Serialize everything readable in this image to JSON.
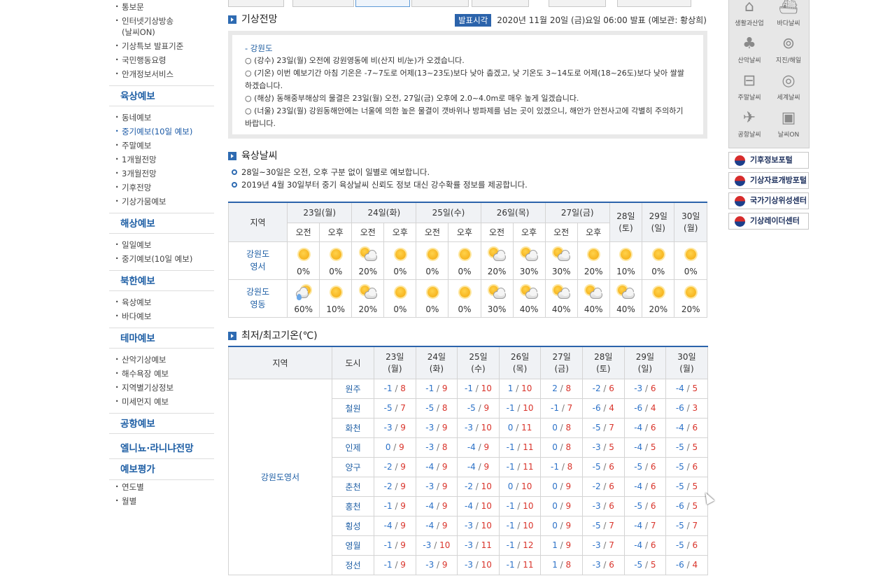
{
  "nav": {
    "group_top": [
      "통보문",
      "인터넷기상방송 (날씨ON)",
      "기상특보 발표기준",
      "국민행동요령",
      "안개정보서비스"
    ],
    "land_head": "육상예보",
    "land_items": [
      "동네예보",
      "중기예보(10일 예보)",
      "주말예보",
      "1개월전망",
      "3개월전망",
      "기후전망",
      "기상가뭄예보"
    ],
    "marine_head": "해상예보",
    "marine_items": [
      "일일예보",
      "중기예보(10일 예보)"
    ],
    "nk_head": "북한예보",
    "nk_items": [
      "육상예보",
      "바다예보"
    ],
    "theme_head": "테마예보",
    "theme_items": [
      "산악기상예보",
      "해수욕장 예보",
      "지역별기상정보",
      "미세먼지 예보"
    ],
    "airport_head": "공항예보",
    "elnino_head": "엘니뇨·라니냐전망",
    "eval_head": "예보평가",
    "eval_items": [
      "연도별",
      "월별"
    ]
  },
  "outlook": {
    "title": "기상전망",
    "pub_label": "발표시각",
    "pub_text": "2020년 11월 20일 (금)요일 06:00 발표 (예보관: 황상희)",
    "region": "- 강원도",
    "lines": [
      "○ (강수) 23일(월) 오전에 강원영동에 비(산지 비/눈)가 오겠습니다.",
      "○ (기온) 이번 예보기간 아침 기온은 -7~7도로 어제(13~23도)보다 낮아 춥겠고, 낮 기온도 3~14도로 어제(18~26도)보다 낮아 쌀쌀하겠습니다.",
      "○ (해상) 동해중부해상의 물결은 23일(월) 오전, 27일(금) 오후에 2.0~4.0m로 매우 높게 일겠습니다.",
      "○ (너울) 23일(월) 강원동해안에는 너울에 의한 높은 물결이 갯바위나 방파제를 넘는 곳이 있겠으니, 해안가 안전사고에 각별히 주의하기 바랍니다."
    ]
  },
  "land": {
    "title": "육상날씨",
    "notes": [
      "28일~30일은 오전, 오후 구분 없이 일별로 예보합니다.",
      "2019년 4월 30일부터 중기 육상날씨 신뢰도 정보 대신 강수확률 정보를 제공합니다."
    ],
    "region_header": "지역",
    "days_split": [
      "23일(월)",
      "24일(화)",
      "25일(수)",
      "26일(목)",
      "27일(금)"
    ],
    "days_single": [
      "28일\n(토)",
      "29일\n(일)",
      "30일\n(월)"
    ],
    "am": "오전",
    "pm": "오후",
    "rows": [
      {
        "region": "강원도\n영서",
        "icons": [
          "sun",
          "sun",
          "suncloud",
          "sun",
          "sun",
          "sun",
          "suncloud",
          "suncloud",
          "suncloud",
          "sun",
          "sun",
          "sun",
          "sun"
        ],
        "pct": [
          "0%",
          "0%",
          "20%",
          "0%",
          "0%",
          "0%",
          "20%",
          "30%",
          "30%",
          "20%",
          "10%",
          "0%",
          "0%"
        ]
      },
      {
        "region": "강원도\n영동",
        "icons": [
          "rain",
          "sun",
          "suncloud",
          "sun",
          "sun",
          "sun",
          "suncloud",
          "suncloud",
          "suncloud",
          "suncloud",
          "suncloud",
          "sun",
          "sun"
        ],
        "pct": [
          "60%",
          "10%",
          "20%",
          "0%",
          "0%",
          "0%",
          "30%",
          "40%",
          "40%",
          "40%",
          "40%",
          "20%",
          "20%"
        ]
      }
    ]
  },
  "temp": {
    "title": "최저/최고기온(℃)",
    "h_region": "지역",
    "h_city": "도시",
    "days": [
      "23일\n(월)",
      "24일\n(화)",
      "25일\n(수)",
      "26일\n(목)",
      "27일\n(금)",
      "28일\n(토)",
      "29일\n(일)",
      "30일\n(월)"
    ],
    "region": "강원도영서",
    "rows": [
      {
        "city": "원주",
        "v": [
          [
            "-1",
            "8"
          ],
          [
            "-1",
            "9"
          ],
          [
            "-1",
            "10"
          ],
          [
            "1",
            "10"
          ],
          [
            "2",
            "8"
          ],
          [
            "-2",
            "6"
          ],
          [
            "-3",
            "6"
          ],
          [
            "-4",
            "5"
          ]
        ]
      },
      {
        "city": "철원",
        "v": [
          [
            "-5",
            "7"
          ],
          [
            "-5",
            "8"
          ],
          [
            "-5",
            "9"
          ],
          [
            "-1",
            "10"
          ],
          [
            "-1",
            "7"
          ],
          [
            "-6",
            "4"
          ],
          [
            "-6",
            "4"
          ],
          [
            "-6",
            "3"
          ]
        ]
      },
      {
        "city": "화천",
        "v": [
          [
            "-3",
            "9"
          ],
          [
            "-3",
            "9"
          ],
          [
            "-3",
            "10"
          ],
          [
            "0",
            "11"
          ],
          [
            "0",
            "8"
          ],
          [
            "-5",
            "7"
          ],
          [
            "-4",
            "6"
          ],
          [
            "-4",
            "6"
          ]
        ]
      },
      {
        "city": "인제",
        "v": [
          [
            "0",
            "9"
          ],
          [
            "-3",
            "8"
          ],
          [
            "-4",
            "9"
          ],
          [
            "-1",
            "11"
          ],
          [
            "0",
            "8"
          ],
          [
            "-3",
            "5"
          ],
          [
            "-4",
            "5"
          ],
          [
            "-5",
            "5"
          ]
        ]
      },
      {
        "city": "양구",
        "v": [
          [
            "-2",
            "9"
          ],
          [
            "-4",
            "9"
          ],
          [
            "-4",
            "9"
          ],
          [
            "-1",
            "11"
          ],
          [
            "-1",
            "8"
          ],
          [
            "-5",
            "6"
          ],
          [
            "-5",
            "6"
          ],
          [
            "-5",
            "6"
          ]
        ]
      },
      {
        "city": "춘천",
        "v": [
          [
            "-2",
            "9"
          ],
          [
            "-3",
            "9"
          ],
          [
            "-2",
            "10"
          ],
          [
            "0",
            "10"
          ],
          [
            "0",
            "9"
          ],
          [
            "-2",
            "6"
          ],
          [
            "-4",
            "6"
          ],
          [
            "-5",
            "5"
          ]
        ]
      },
      {
        "city": "홍천",
        "v": [
          [
            "-1",
            "9"
          ],
          [
            "-4",
            "9"
          ],
          [
            "-4",
            "10"
          ],
          [
            "-1",
            "10"
          ],
          [
            "0",
            "9"
          ],
          [
            "-3",
            "6"
          ],
          [
            "-5",
            "6"
          ],
          [
            "-6",
            "5"
          ]
        ]
      },
      {
        "city": "횡성",
        "v": [
          [
            "-4",
            "9"
          ],
          [
            "-4",
            "9"
          ],
          [
            "-3",
            "10"
          ],
          [
            "-1",
            "10"
          ],
          [
            "0",
            "9"
          ],
          [
            "-5",
            "7"
          ],
          [
            "-4",
            "7"
          ],
          [
            "-5",
            "7"
          ]
        ]
      },
      {
        "city": "영월",
        "v": [
          [
            "-1",
            "9"
          ],
          [
            "-3",
            "10"
          ],
          [
            "-3",
            "11"
          ],
          [
            "-1",
            "12"
          ],
          [
            "1",
            "9"
          ],
          [
            "-3",
            "7"
          ],
          [
            "-4",
            "6"
          ],
          [
            "-5",
            "6"
          ]
        ]
      },
      {
        "city": "정선",
        "v": [
          [
            "-1",
            "9"
          ],
          [
            "-3",
            "9"
          ],
          [
            "-3",
            "10"
          ],
          [
            "-1",
            "11"
          ],
          [
            "1",
            "8"
          ],
          [
            "-3",
            "6"
          ],
          [
            "-5",
            "5"
          ],
          [
            "-6",
            "4"
          ]
        ]
      }
    ]
  },
  "side": {
    "icons": [
      {
        "label": "생활과산업",
        "icon": "house-icon",
        "glyph": "⌂"
      },
      {
        "label": "바다날씨",
        "icon": "ship-icon",
        "glyph": "⛴"
      },
      {
        "label": "산악날씨",
        "icon": "tree-icon",
        "glyph": "♣"
      },
      {
        "label": "지진/해일",
        "icon": "antenna-icon",
        "glyph": "⊚"
      },
      {
        "label": "주말날씨",
        "icon": "car-icon",
        "glyph": "⊟"
      },
      {
        "label": "세계날씨",
        "icon": "globe-icon",
        "glyph": "◎"
      },
      {
        "label": "공항날씨",
        "icon": "plane-icon",
        "glyph": "✈"
      },
      {
        "label": "날씨ON",
        "icon": "tv-icon",
        "glyph": "▣"
      }
    ],
    "banners": [
      "기후정보포털",
      "기상자료개방포털",
      "국가기상위성센터",
      "기상레이더센터"
    ]
  }
}
